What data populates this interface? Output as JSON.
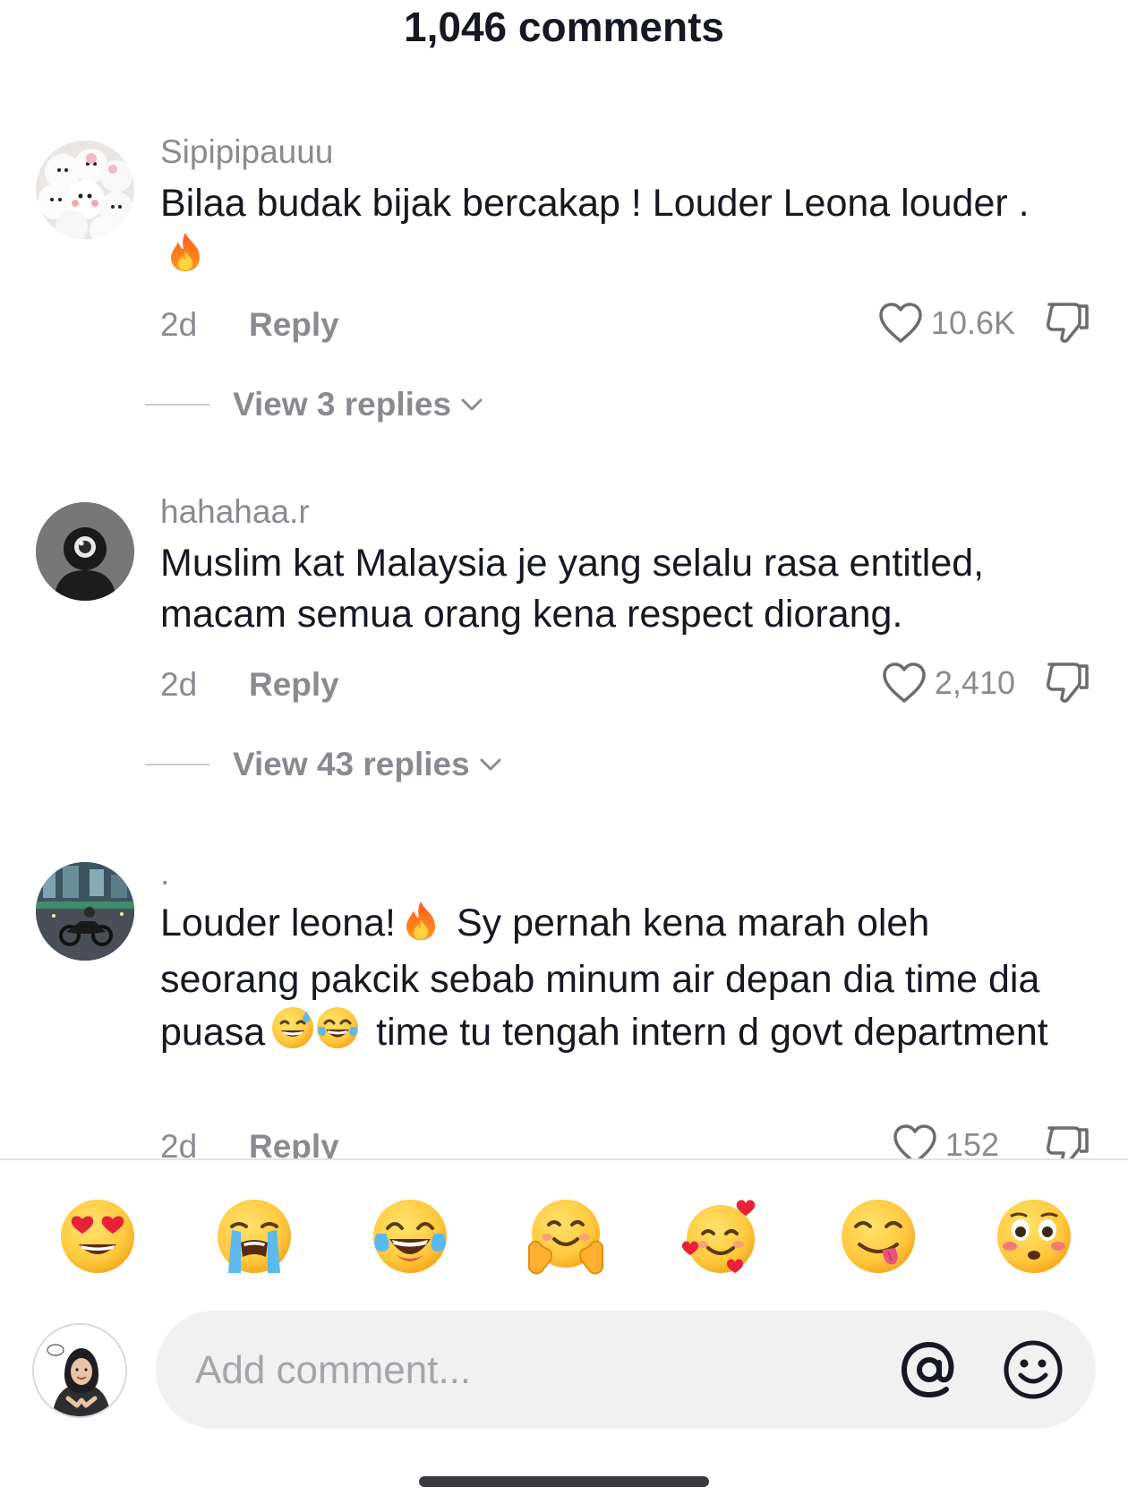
{
  "header": {
    "title": "1,046 comments"
  },
  "comments": [
    {
      "username": "Sipipipauuu",
      "text_before": "Bilaa budak bijak bercakap ! Louder Leona louder .",
      "emoji": "fire-emoji",
      "time": "2d",
      "reply_label": "Reply",
      "likes": "10.6K",
      "view_replies": "View 3 replies"
    },
    {
      "username": "hahahaa.r",
      "text": "Muslim kat Malaysia je yang selalu rasa entitled, macam semua orang kena respect diorang.",
      "time": "2d",
      "reply_label": "Reply",
      "likes": "2,410",
      "view_replies": "View 43 replies"
    },
    {
      "username": ".",
      "text_part1": "Louder leona!",
      "text_part2": "Sy pernah kena marah oleh seorang pakcik sebab minum air depan dia time dia puasa",
      "text_part3": "time tu tengah intern d govt department",
      "time": "2d",
      "reply_label": "Reply",
      "likes": "152"
    }
  ],
  "emoji_bar": [
    "heart-eyes-emoji",
    "loudly-crying-emoji",
    "tears-of-joy-emoji",
    "hugging-emoji",
    "smiling-face-with-hearts-emoji",
    "yum-emoji",
    "flushed-emoji"
  ],
  "composer": {
    "placeholder": "Add comment..."
  },
  "colors": {
    "text_primary": "#161823",
    "text_secondary": "#8a8b91",
    "input_bg": "#f1f1f2",
    "emoji_yellow": "#ffc83d",
    "fire_orange": "#ff7a1a"
  }
}
